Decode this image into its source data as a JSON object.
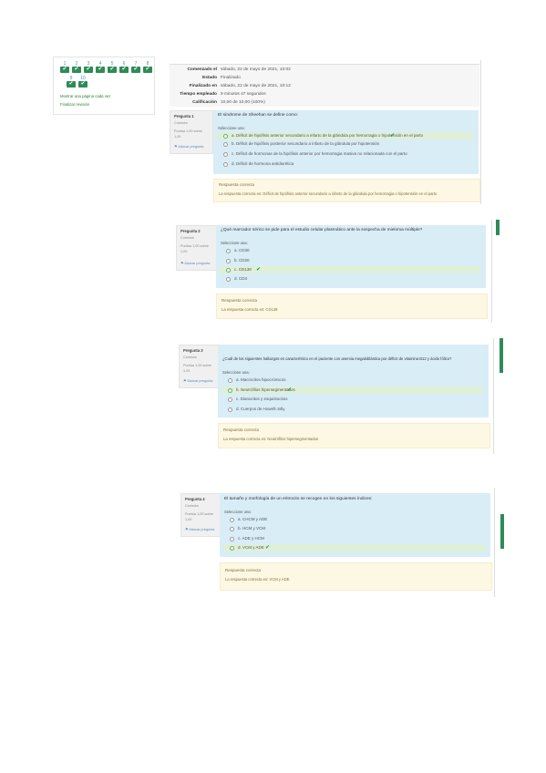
{
  "nav": {
    "row1": [
      "1",
      "2",
      "3",
      "4",
      "5",
      "6",
      "7",
      "8"
    ],
    "row2": [
      "9",
      "10"
    ],
    "check": "✔",
    "link1": "Mostrar una página cada vez",
    "link2": "Finalizar revisión"
  },
  "summary": [
    {
      "label": "Comenzado el",
      "value": "sábado, 22 de mayo de 2021, 10:02"
    },
    {
      "label": "Estado",
      "value": "Finalizado"
    },
    {
      "label": "Finalizado en",
      "value": "sábado, 22 de mayo de 2021, 10:12"
    },
    {
      "label": "Tiempo empleado",
      "value": "9 minutos 47 segundos"
    },
    {
      "label": "Calificación",
      "value": "10,00 de 10,00 (100%)"
    }
  ],
  "questions": [
    {
      "info": {
        "title": "Pregunta 1",
        "status": "Correcta",
        "mark": "Puntúa 1,00 sobre",
        "mark2": "1,00",
        "flag": "Marcar pregunta"
      },
      "text": "El síndrome de Sheehan se define como:",
      "select": "Seleccione una:",
      "options": [
        "a. Déficit de hipófisis anterior secundario a infarto de la glándula por hemorragia o hipotensión en el parto",
        "b. Déficit de hipófisis posterior secundario a infarto de la glándula por hipotensión",
        "c. Déficit de hormonas de la hipófisis anterior por hemorragia masiva no relacionada con el parto",
        "d. Déficit de hormona antidiurética"
      ],
      "correct_index": 0,
      "feedback_title": "Respuesta correcta",
      "feedback_text": "La respuesta correcta es: Déficit de hipófisis anterior secundario a infarto de la glándula por hemorragia o hipotensión en el parto"
    },
    {
      "info": {
        "title": "Pregunta 2",
        "status": "Correcta",
        "mark": "Puntúa 1,00 sobre",
        "mark2": "1,00",
        "flag": "Marcar pregunta"
      },
      "text": "¿Qué marcador sérico se pide para el estudio celular plasmático ante la sospecha de mieloma múltiple?",
      "select": "Seleccione una:",
      "options": [
        "a. CD30",
        "b. CD20",
        "c. CD138",
        "d. CD3"
      ],
      "correct_index": 2,
      "feedback_title": "Respuesta correcta",
      "feedback_text": "La respuesta correcta es: CD138"
    },
    {
      "info": {
        "title": "Pregunta 3",
        "status": "Correcta",
        "mark": "Puntúa 1,00 sobre",
        "mark2": "1,00",
        "flag": "Marcar pregunta"
      },
      "text": "¿Cuál de los siguientes hallazgos es característico en el paciente con anemia megaloblástica por déficit de vitamina B12 y ácido fólico?",
      "select": "Seleccione una:",
      "options": [
        "a. Macrocitos hipocrómicos",
        "b. Neutrófilos hipersegmentados",
        "c. Dianocitos y esquistocitos",
        "d. Cuerpos de Howell-Jolly"
      ],
      "correct_index": 1,
      "feedback_title": "Respuesta correcta",
      "feedback_text": "La respuesta correcta es: Neutrófilos hipersegmentados"
    },
    {
      "info": {
        "title": "Pregunta 4",
        "status": "Correcta",
        "mark": "Puntúa 1,00 sobre",
        "mark2": "1,00",
        "flag": "Marcar pregunta"
      },
      "text": "El tamaño y morfología de un eritrocito se recogen en los siguientes índices:",
      "select": "Seleccione una:",
      "options": [
        "a. CHCM y ADE",
        "b. HCM y VCM",
        "c. ADE y HCM",
        "d. VCM y ADE"
      ],
      "correct_index": 3,
      "feedback_title": "Respuesta correcta",
      "feedback_text": "La respuesta correcta es: VCM y ADE"
    }
  ]
}
